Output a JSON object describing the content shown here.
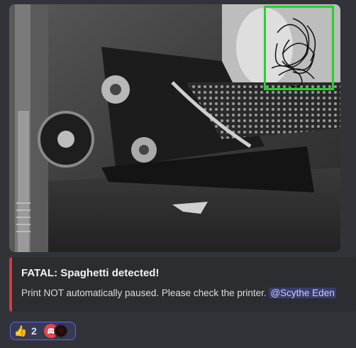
{
  "photo": {
    "alt": "",
    "detection_box_color": "#22d32a"
  },
  "embed": {
    "title": "FATAL: Spaghetti detected!",
    "description": "Print NOT automatically paused. Please check the printer.",
    "mention": "@Scythe Eden",
    "accent_color": "#da373c"
  },
  "reaction": {
    "emoji": "👍",
    "count": "2",
    "avatar_icons": [
      "discord-logo-icon",
      "user-avatar-icon"
    ]
  }
}
